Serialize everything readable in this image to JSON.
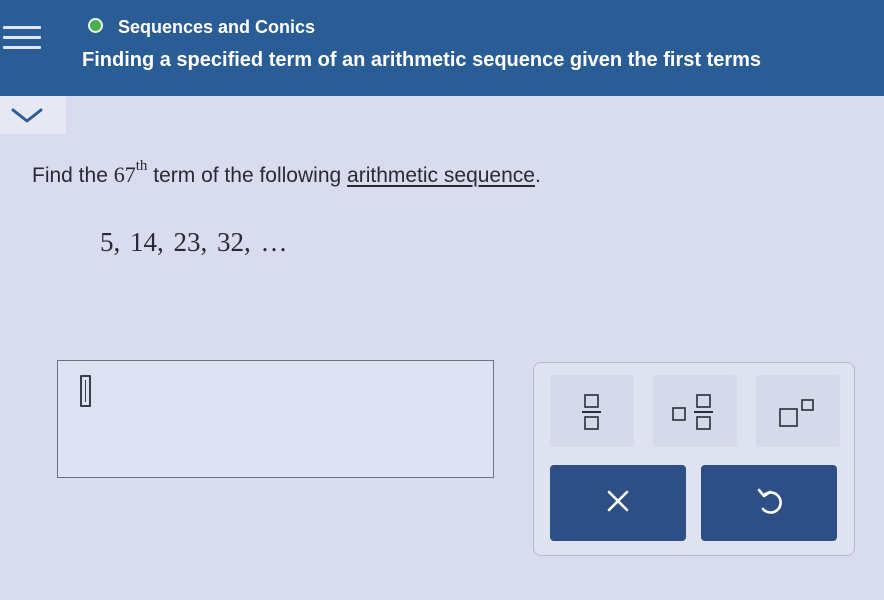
{
  "header": {
    "topic": "Sequences and Conics",
    "subtitle": "Finding a specified term of an arithmetic sequence given the first terms"
  },
  "question": {
    "prefix": "Find the",
    "term_number": "67",
    "term_suffix": "th",
    "middle": "term of the following",
    "link_text": "arithmetic sequence",
    "end": "."
  },
  "sequence": "5,  14,  23,  32,  …",
  "answer": {
    "value": ""
  },
  "colors": {
    "header_bg": "#2a5c95",
    "status_dot": "#4cae4c",
    "action_button": "#2d4f86"
  },
  "icons": {
    "menu": "hamburger-icon",
    "collapse": "chevron-down-icon",
    "status": "status-dot-icon",
    "fraction": "fraction-icon",
    "mixed_number": "mixed-number-icon",
    "exponent": "exponent-icon",
    "clear": "close-x-icon",
    "undo": "undo-icon"
  }
}
